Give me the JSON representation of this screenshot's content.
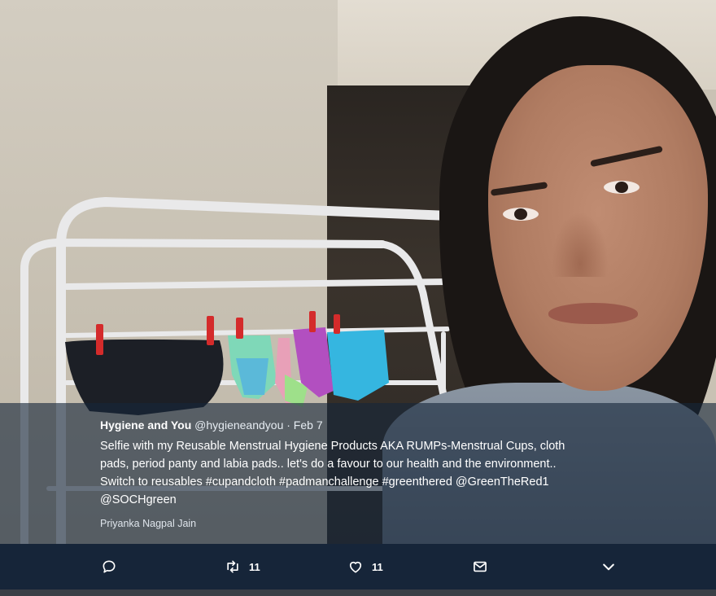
{
  "tweet": {
    "display_name": "Hygiene and You",
    "handle": "@hygieneandyou",
    "date": "· Feb 7",
    "lines": [
      "Selfie with my Reusable Menstrual Hygiene Products AKA RUMPs-Menstrual Cups, cloth",
      "pads, period panty and labia pads.. let's do a favour to our health and the environment..",
      "Switch to reusables #cupandcloth #padmanchallenge #greenthered @GreenTheRed1",
      "@SOCHgreen"
    ],
    "photo_credit": "Priyanka Nagpal Jain"
  },
  "actions": {
    "reply_icon": "reply-icon",
    "retweet_icon": "retweet-icon",
    "retweet_count": "11",
    "like_icon": "heart-icon",
    "like_count": "11",
    "message_icon": "envelope-icon",
    "more_icon": "chevron-down-icon"
  },
  "colors": {
    "caption_overlay": "#16263a",
    "action_bar": "#162539",
    "text": "#ffffff"
  }
}
